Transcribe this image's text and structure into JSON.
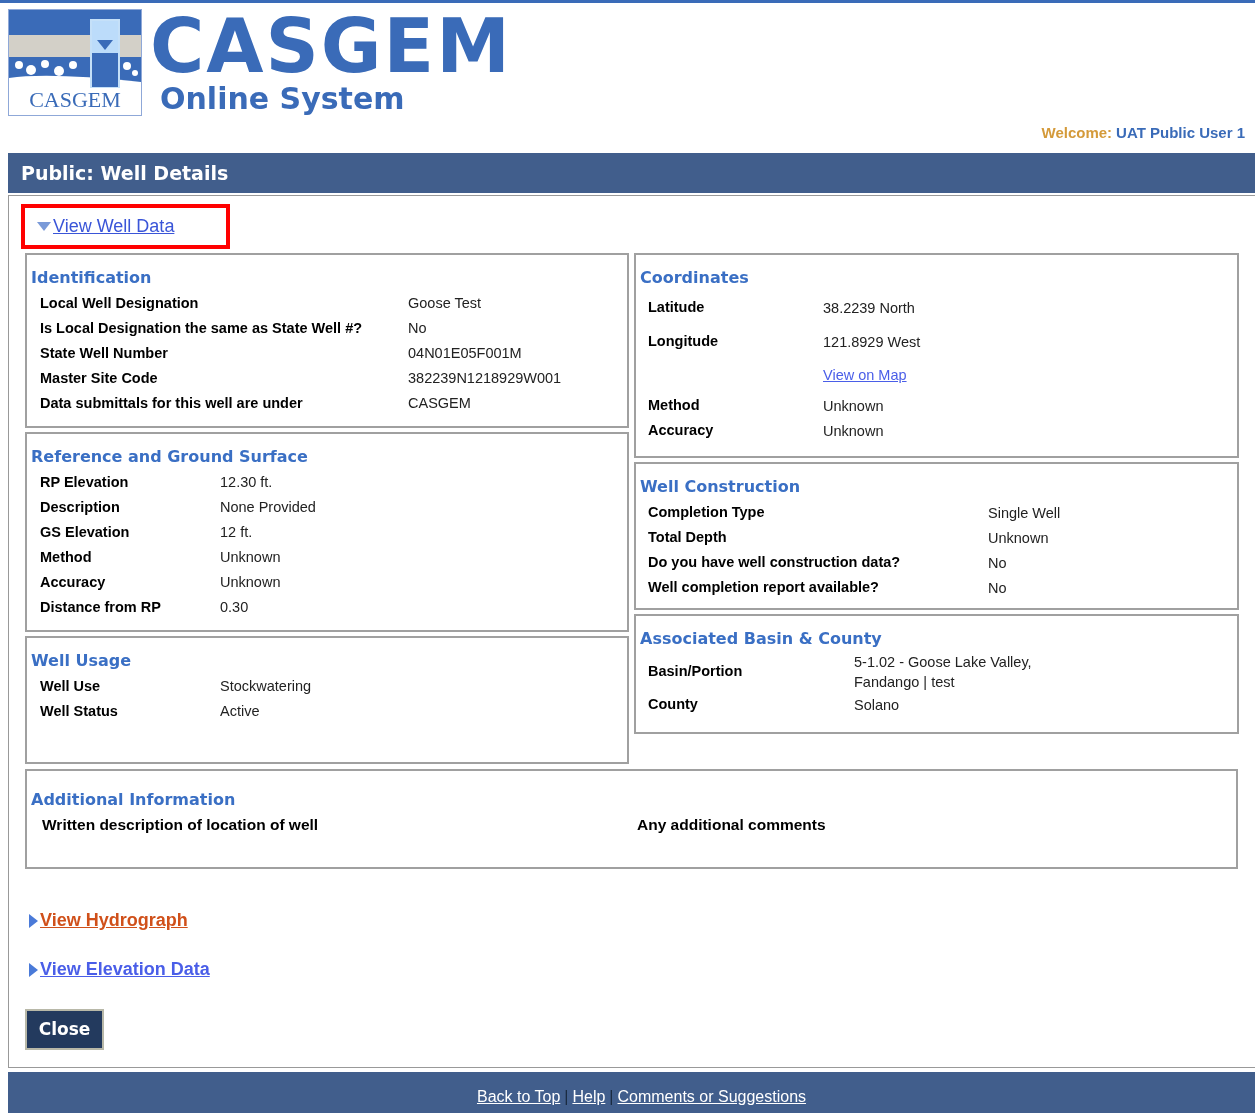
{
  "logo": {
    "caption": "CASGEM"
  },
  "site_title": "CASGEM",
  "site_subtitle": "Online System",
  "welcome": {
    "label": "Welcome:",
    "user": "UAT Public User 1"
  },
  "page_title": "Public: Well Details",
  "well_data_toggle": {
    "label": "View Well Data",
    "expanded": true,
    "annotated": true
  },
  "left_sections": [
    {
      "title": "Identification",
      "rows": [
        {
          "label": "Local Well Designation",
          "value": "Goose Test"
        },
        {
          "label": "Is Local Designation the same as State Well #?",
          "value": "No"
        },
        {
          "label": "State Well Number",
          "value": "04N01E05F001M"
        },
        {
          "label": "Master Site Code",
          "value": "382239N1218929W001"
        },
        {
          "label": "Data submittals for this well are under",
          "value": "CASGEM"
        }
      ]
    },
    {
      "title": "Reference and Ground Surface",
      "rows": [
        {
          "label": "RP Elevation",
          "value": "12.30  ft."
        },
        {
          "label": "Description",
          "value": "None Provided"
        },
        {
          "label": "GS Elevation",
          "value": "12  ft."
        },
        {
          "label": "Method",
          "value": "Unknown"
        },
        {
          "label": "Accuracy",
          "value": "Unknown"
        },
        {
          "label": "Distance from RP",
          "value": "0.30"
        }
      ]
    },
    {
      "title": "Well Usage",
      "rows": [
        {
          "label": "Well Use",
          "value": "Stockwatering"
        },
        {
          "label": "Well Status",
          "value": "Active"
        }
      ]
    }
  ],
  "right_sections": [
    {
      "title": "Coordinates",
      "rows": [
        {
          "kind": "pair",
          "label": "Latitude",
          "value": "38.2239 North"
        },
        {
          "kind": "pair",
          "label": "Longitude",
          "value": "121.8929 West"
        },
        {
          "kind": "link",
          "value": "View on Map"
        },
        {
          "kind": "pair",
          "label": "Method",
          "value": "Unknown"
        },
        {
          "kind": "pair",
          "label": "Accuracy",
          "value": "Unknown"
        }
      ]
    },
    {
      "title": "Well Construction",
      "rows": [
        {
          "kind": "pair",
          "label": "Completion Type",
          "value": "Single Well"
        },
        {
          "kind": "pair",
          "label": "Total Depth",
          "value": "Unknown"
        },
        {
          "kind": "pair",
          "label": "Do you have well construction data?",
          "value": "No"
        },
        {
          "kind": "pair",
          "label": "Well completion report available?",
          "value": "No"
        }
      ]
    },
    {
      "title": "Associated Basin & County",
      "rows": [
        {
          "kind": "pair",
          "label": "Basin/Portion",
          "value": "5-1.02 - Goose Lake Valley, Fandango | test"
        },
        {
          "kind": "pair",
          "label": "County",
          "value": "Solano"
        }
      ]
    }
  ],
  "additional_information": {
    "title": "Additional Information",
    "labels": [
      "Written description of location of well",
      "Any additional comments"
    ]
  },
  "toggles": [
    {
      "label": "View Hydrograph",
      "expanded": false,
      "hovered": true
    },
    {
      "label": "View Elevation Data",
      "expanded": false,
      "hovered": false
    }
  ],
  "close_button": "Close",
  "footer": {
    "separator": "|",
    "links": [
      "Back to Top",
      "Help",
      "Comments or Suggestions"
    ]
  }
}
